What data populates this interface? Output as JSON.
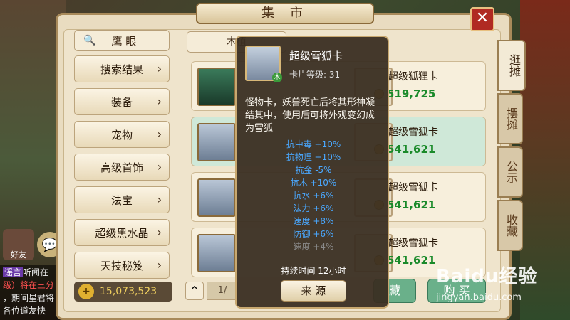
{
  "window": {
    "title": "集 市",
    "close_label": "✕"
  },
  "side_tabs": [
    {
      "label": "逛摊",
      "active": true
    },
    {
      "label": "摆摊",
      "active": false
    },
    {
      "label": "公示",
      "active": false
    },
    {
      "label": "收藏",
      "active": false
    }
  ],
  "left_nav": {
    "search_label": "鹰 眼",
    "items": [
      "搜索结果",
      "装备",
      "宠物",
      "高级首饰",
      "法宝",
      "超级黑水晶",
      "天技秘笈"
    ]
  },
  "tab_label": "木植",
  "items": [
    {
      "name": "超级狐狸卡",
      "price": "519,725",
      "thumb": "dragon"
    },
    {
      "name": "超级雪狐卡",
      "price": "541,621",
      "thumb": "fox"
    },
    {
      "name": "超级雪狐卡",
      "price": "541,621",
      "thumb": "fox"
    },
    {
      "name": "超级雪狐卡",
      "price": "541,621",
      "thumb": "fox"
    }
  ],
  "bottom": {
    "money": "15,073,523",
    "page": "1/",
    "fav_label": "藏",
    "buy_label": "购 买"
  },
  "tooltip": {
    "name": "超级雪狐卡",
    "level": "卡片等级: 31",
    "badge": "木",
    "desc": "怪物卡，妖兽死亡后将其形神凝结其中，使用后可将外观变幻成为雪狐",
    "stats": [
      "抗中毒 +10%",
      "抗物理 +10%",
      "抗金 -5%",
      "抗木 +10%",
      "抗水 +6%",
      "法力 +6%",
      "速度 +8%",
      "防御 +6%",
      "速度 +4%"
    ],
    "duration": "持续时间 12小时",
    "source_label": "来 源"
  },
  "chat": {
    "friend_label": "好友",
    "line1_tag": "谣言",
    "line1": "听闻在",
    "line2": "级）将在三分",
    "line3": "，期间星君将",
    "line4": "各位道友快"
  },
  "watermark": {
    "logo": "Baidu经验",
    "url": "jingyan.baidu.com"
  },
  "colors": {
    "price_green": "#1a8a2a",
    "stat_blue": "#4aa8ff",
    "close_red": "#b02a22"
  }
}
